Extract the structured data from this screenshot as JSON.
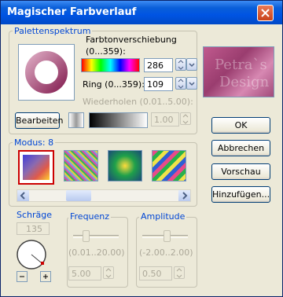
{
  "window": {
    "title": "Magischer Farbverlauf"
  },
  "palette": {
    "group_label": "Palettenspektrum",
    "hue_label": "Farbtonverschiebung",
    "hue_range": "(0...359):",
    "hue_value": "286",
    "ring_label": "Ring (0...359):",
    "ring_value": "109",
    "repeat_label": "Wiederholen (0.01..5.00):",
    "repeat_value": "1.00",
    "edit_button": "Bearbeiten"
  },
  "preview": {
    "watermark_line1": "Petra`s",
    "watermark_line2": "Design"
  },
  "mode": {
    "group_label": "Modus: 8",
    "scroll_position": 0.3
  },
  "bevel": {
    "label": "Schräge",
    "value": "135"
  },
  "frequency": {
    "label": "Frequenz",
    "range": "(0.01..20.00)",
    "value": "5.00",
    "slider_position": 0.25
  },
  "amplitude": {
    "label": "Amplitude",
    "range": "(-2.00..2.00)",
    "value": "0.50",
    "slider_position": 0.56
  },
  "buttons": {
    "ok": "OK",
    "cancel": "Abbrechen",
    "preview": "Vorschau",
    "add": "Hinzufügen..."
  },
  "colors": {
    "title_bar": "#0054e3",
    "group_label": "#0046d5",
    "accent_red": "#cc0000"
  }
}
